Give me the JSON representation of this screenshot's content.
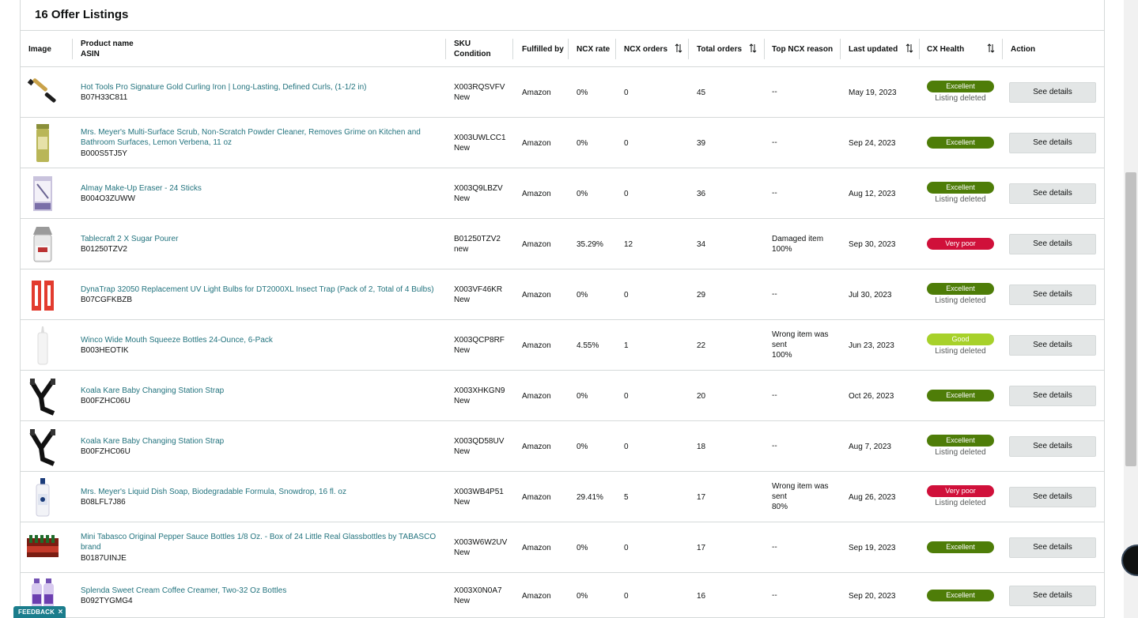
{
  "panel": {
    "title": "16 Offer Listings"
  },
  "columns": {
    "image": "Image",
    "product_name": "Product name",
    "asin": "ASIN",
    "sku": "SKU",
    "condition": "Condition",
    "fulfilled_by": "Fulfilled by",
    "ncx_rate": "NCX rate",
    "ncx_orders": "NCX orders",
    "total_orders": "Total orders",
    "top_ncx_reason": "Top NCX reason",
    "last_updated": "Last updated",
    "cx_health": "CX Health",
    "action": "Action"
  },
  "colors": {
    "excellent": "#4e7d08",
    "very_poor": "#d0103a",
    "good": "#a7d12a",
    "link": "#22737e"
  },
  "rows": [
    {
      "product": "Hot Tools Pro Signature Gold Curling Iron | Long-Lasting, Defined Curls, (1-1/2 in)",
      "product_line2": "",
      "asin": "B07H33C811",
      "sku": "X003RQSVFV",
      "condition": "New",
      "fulfilled_by": "Amazon",
      "ncx_rate": "0%",
      "ncx_orders": "0",
      "total_orders": "45",
      "reason_1": "--",
      "reason_2": "",
      "reason_3": "",
      "last_updated": "May 19, 2023",
      "health": "Excellent",
      "health_key": "excellent",
      "note": "Listing deleted",
      "action": "See details",
      "thumb_icon": "curling-iron-image"
    },
    {
      "product": "Mrs. Meyer's Multi-Surface Scrub, Non-Scratch Powder Cleaner, Removes Grime on Kitchen and",
      "product_line2": "Bathroom Surfaces, Lemon Verbena, 11 oz",
      "asin": "B000S5TJ5Y",
      "sku": "X003UWLCC1",
      "condition": "New",
      "fulfilled_by": "Amazon",
      "ncx_rate": "0%",
      "ncx_orders": "0",
      "total_orders": "39",
      "reason_1": "--",
      "reason_2": "",
      "reason_3": "",
      "last_updated": "Sep 24, 2023",
      "health": "Excellent",
      "health_key": "excellent",
      "note": "",
      "action": "See details",
      "thumb_icon": "scrub-canister-image"
    },
    {
      "product": "Almay Make-Up Eraser - 24 Sticks",
      "product_line2": "",
      "asin": "B004O3ZUWW",
      "sku": "X003Q9LBZV",
      "condition": "New",
      "fulfilled_by": "Amazon",
      "ncx_rate": "0%",
      "ncx_orders": "0",
      "total_orders": "36",
      "reason_1": "--",
      "reason_2": "",
      "reason_3": "",
      "last_updated": "Aug 12, 2023",
      "health": "Excellent",
      "health_key": "excellent",
      "note": "Listing deleted",
      "action": "See details",
      "thumb_icon": "makeup-eraser-image"
    },
    {
      "product": "Tablecraft 2 X Sugar Pourer",
      "product_line2": "",
      "asin": "B01250TZV2",
      "sku": "B01250TZV2",
      "condition": "new",
      "fulfilled_by": "Amazon",
      "ncx_rate": "35.29%",
      "ncx_orders": "12",
      "total_orders": "34",
      "reason_1": "Damaged item",
      "reason_2": "100%",
      "reason_3": "",
      "last_updated": "Sep 30, 2023",
      "health": "Very poor",
      "health_key": "very_poor",
      "note": "",
      "action": "See details",
      "thumb_icon": "sugar-pourer-image"
    },
    {
      "product": "DynaTrap 32050 Replacement UV Light Bulbs for DT2000XL Insect Trap (Pack of 2, Total of 4 Bulbs)",
      "product_line2": "",
      "asin": "B07CGFKBZB",
      "sku": "X003VF46KR",
      "condition": "New",
      "fulfilled_by": "Amazon",
      "ncx_rate": "0%",
      "ncx_orders": "0",
      "total_orders": "29",
      "reason_1": "--",
      "reason_2": "",
      "reason_3": "",
      "last_updated": "Jul 30, 2023",
      "health": "Excellent",
      "health_key": "excellent",
      "note": "Listing deleted",
      "action": "See details",
      "thumb_icon": "uv-bulbs-image"
    },
    {
      "product": "Winco Wide Mouth Squeeze Bottles 24-Ounce, 6-Pack",
      "product_line2": "",
      "asin": "B003HEOTIK",
      "sku": "X003QCP8RF",
      "condition": "New",
      "fulfilled_by": "Amazon",
      "ncx_rate": "4.55%",
      "ncx_orders": "1",
      "total_orders": "22",
      "reason_1": "Wrong item was",
      "reason_2": "sent",
      "reason_3": "100%",
      "last_updated": "Jun 23, 2023",
      "health": "Good",
      "health_key": "good",
      "note": "Listing deleted",
      "action": "See details",
      "thumb_icon": "squeeze-bottle-image"
    },
    {
      "product": "Koala Kare Baby Changing Station Strap",
      "product_line2": "",
      "asin": "B00FZHC06U",
      "sku": "X003XHKGN9",
      "condition": "New",
      "fulfilled_by": "Amazon",
      "ncx_rate": "0%",
      "ncx_orders": "0",
      "total_orders": "20",
      "reason_1": "--",
      "reason_2": "",
      "reason_3": "",
      "last_updated": "Oct 26, 2023",
      "health": "Excellent",
      "health_key": "excellent",
      "note": "",
      "action": "See details",
      "thumb_icon": "strap-image"
    },
    {
      "product": "Koala Kare Baby Changing Station Strap",
      "product_line2": "",
      "asin": "B00FZHC06U",
      "sku": "X003QD58UV",
      "condition": "New",
      "fulfilled_by": "Amazon",
      "ncx_rate": "0%",
      "ncx_orders": "0",
      "total_orders": "18",
      "reason_1": "--",
      "reason_2": "",
      "reason_3": "",
      "last_updated": "Aug 7, 2023",
      "health": "Excellent",
      "health_key": "excellent",
      "note": "Listing deleted",
      "action": "See details",
      "thumb_icon": "strap-image"
    },
    {
      "product": "Mrs. Meyer's Liquid Dish Soap, Biodegradable Formula, Snowdrop, 16 fl. oz",
      "product_line2": "",
      "asin": "B08LFL7J86",
      "sku": "X003WB4P51",
      "condition": "New",
      "fulfilled_by": "Amazon",
      "ncx_rate": "29.41%",
      "ncx_orders": "5",
      "total_orders": "17",
      "reason_1": "Wrong item was",
      "reason_2": "sent",
      "reason_3": "80%",
      "last_updated": "Aug 26, 2023",
      "health": "Very poor",
      "health_key": "very_poor",
      "note": "Listing deleted",
      "action": "See details",
      "thumb_icon": "dish-soap-image"
    },
    {
      "product": "Mini Tabasco Original Pepper Sauce Bottles 1/8 Oz. - Box of 24 Little Real Glassbottles by TABASCO",
      "product_line2": "brand",
      "asin": "B0187UINJE",
      "sku": "X003W6W2UV",
      "condition": "New",
      "fulfilled_by": "Amazon",
      "ncx_rate": "0%",
      "ncx_orders": "0",
      "total_orders": "17",
      "reason_1": "--",
      "reason_2": "",
      "reason_3": "",
      "last_updated": "Sep 19, 2023",
      "health": "Excellent",
      "health_key": "excellent",
      "note": "",
      "action": "See details",
      "thumb_icon": "tabasco-box-image"
    },
    {
      "product": "Splenda Sweet Cream Coffee Creamer, Two-32 Oz Bottles",
      "product_line2": "",
      "asin": "B092TYGMG4",
      "sku": "X003X0N0A7",
      "condition": "New",
      "fulfilled_by": "Amazon",
      "ncx_rate": "0%",
      "ncx_orders": "0",
      "total_orders": "16",
      "reason_1": "--",
      "reason_2": "",
      "reason_3": "",
      "last_updated": "Sep 20, 2023",
      "health": "Excellent",
      "health_key": "excellent",
      "note": "",
      "action": "See details",
      "thumb_icon": "creamer-bottles-image"
    }
  ],
  "feedback": {
    "label": "FEEDBACK",
    "close": "×"
  }
}
